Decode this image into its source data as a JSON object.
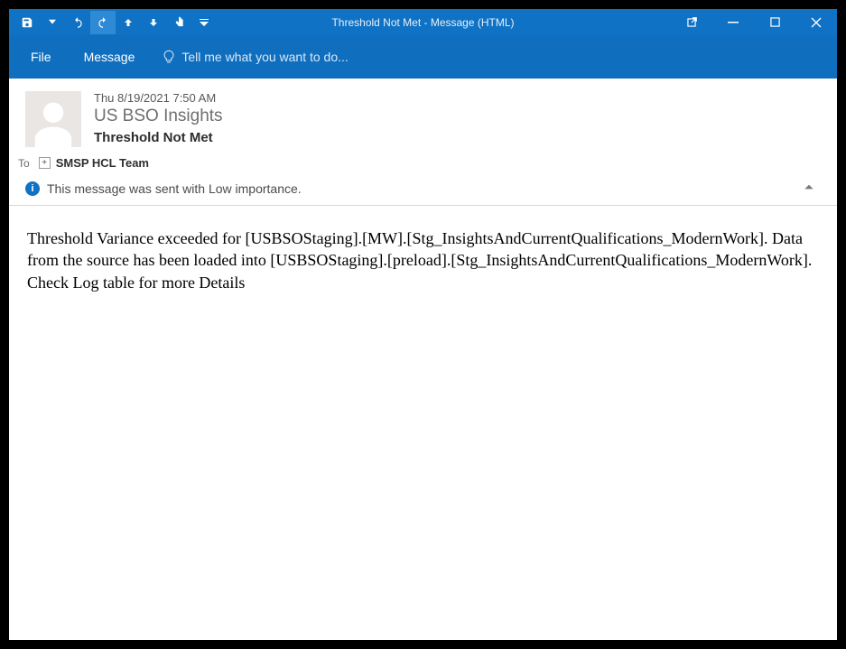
{
  "window": {
    "title": "Threshold Not Met - Message (HTML)"
  },
  "qat": {
    "save": "save-icon",
    "undo": "undo-icon",
    "redo": "redo-icon",
    "refresh": "refresh-icon",
    "prev": "prev-icon",
    "next": "next-icon",
    "down": "down-icon",
    "pointer": "pointer-icon"
  },
  "ribbon": {
    "file": "File",
    "message": "Message",
    "tell_me": "Tell me what you want to do..."
  },
  "header": {
    "date": "Thu 8/19/2021 7:50 AM",
    "sender": "US BSO Insights",
    "subject": "Threshold Not Met",
    "to_label": "To",
    "recipient": "SMSP HCL Team",
    "importance_text": "This message was sent with Low importance."
  },
  "body": {
    "text": "Threshold Variance exceeded for [USBSOStaging].[MW].[Stg_InsightsAndCurrentQualifications_ModernWork]. Data from the source has been loaded into [USBSOStaging].[preload].[Stg_InsightsAndCurrentQualifications_ModernWork]. Check Log table for more Details"
  }
}
